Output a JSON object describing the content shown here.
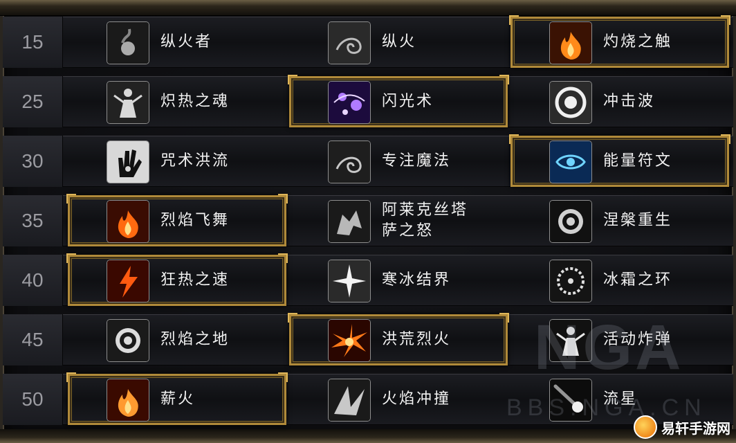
{
  "rows": [
    {
      "level": "15",
      "talents": [
        {
          "name": "纵火者",
          "picked": false,
          "icon": "pyromaniac-icon"
        },
        {
          "name": "纵火",
          "picked": false,
          "icon": "conflagration-icon"
        },
        {
          "name": "灼烧之触",
          "picked": true,
          "icon": "searing-touch-icon"
        }
      ]
    },
    {
      "level": "25",
      "talents": [
        {
          "name": "炽热之魂",
          "picked": false,
          "icon": "blazing-soul-icon"
        },
        {
          "name": "闪光术",
          "picked": true,
          "icon": "shimmer-icon"
        },
        {
          "name": "冲击波",
          "picked": false,
          "icon": "blast-wave-icon"
        }
      ]
    },
    {
      "level": "30",
      "talents": [
        {
          "name": "咒术洪流",
          "picked": false,
          "icon": "incanters-flow-icon"
        },
        {
          "name": "专注魔法",
          "picked": false,
          "icon": "focus-magic-icon"
        },
        {
          "name": "能量符文",
          "picked": true,
          "icon": "rune-of-power-icon"
        }
      ]
    },
    {
      "level": "35",
      "talents": [
        {
          "name": "烈焰飞舞",
          "picked": true,
          "icon": "flame-on-icon"
        },
        {
          "name": "阿莱克丝塔萨之怒",
          "picked": false,
          "icon": "alexstraszas-fury-icon"
        },
        {
          "name": "涅槃重生",
          "picked": false,
          "icon": "from-the-ashes-icon"
        }
      ]
    },
    {
      "level": "40",
      "talents": [
        {
          "name": "狂热之速",
          "picked": true,
          "icon": "frenetic-speed-icon"
        },
        {
          "name": "寒冰结界",
          "picked": false,
          "icon": "ice-ward-icon"
        },
        {
          "name": "冰霜之环",
          "picked": false,
          "icon": "ring-of-frost-icon"
        }
      ]
    },
    {
      "level": "45",
      "talents": [
        {
          "name": "烈焰之地",
          "picked": false,
          "icon": "flame-patch-icon"
        },
        {
          "name": "洪荒烈火",
          "picked": true,
          "icon": "conflagration-fire-icon"
        },
        {
          "name": "活动炸弹",
          "picked": false,
          "icon": "living-bomb-icon"
        }
      ]
    },
    {
      "level": "50",
      "talents": [
        {
          "name": "薪火",
          "picked": true,
          "icon": "kindling-icon"
        },
        {
          "name": "火焰冲撞",
          "picked": false,
          "icon": "pyroclasm-icon"
        },
        {
          "name": "流星",
          "picked": false,
          "icon": "meteor-icon"
        }
      ]
    }
  ],
  "watermark": {
    "brand": "NGA",
    "site": "BBS.NGA.CN"
  },
  "logo": {
    "text": "易轩手游网"
  },
  "colors": {
    "selected_border": "#b08a3a",
    "row_bg": "#15161a",
    "level_text": "#9c9ca2"
  }
}
